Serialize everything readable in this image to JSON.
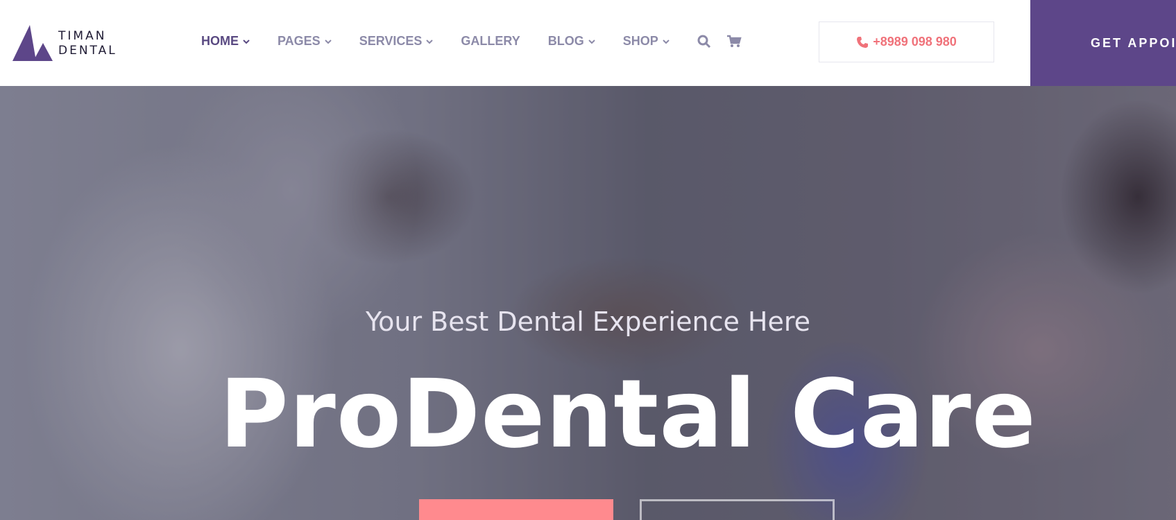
{
  "brand": {
    "line1": "TIMAN",
    "line2": "DENTAL",
    "accent": "#5d4689"
  },
  "nav": {
    "items": [
      {
        "label": "HOME",
        "dropdown": true,
        "active": true
      },
      {
        "label": "PAGES",
        "dropdown": true
      },
      {
        "label": "SERVICES",
        "dropdown": true
      },
      {
        "label": "GALLERY",
        "dropdown": false
      },
      {
        "label": "BLOG",
        "dropdown": true
      },
      {
        "label": "SHOP",
        "dropdown": true
      }
    ],
    "icons": [
      "search-icon",
      "cart-icon"
    ]
  },
  "contact": {
    "phone": "+8989 098 980",
    "icon": "phone-icon",
    "color": "#f0727a"
  },
  "cta": {
    "label": "GET APPOI"
  },
  "hero": {
    "subtitle": "Your Best Dental Experience Here",
    "title": "ProDental Care",
    "primary_button_color": "#ff8a8e"
  }
}
